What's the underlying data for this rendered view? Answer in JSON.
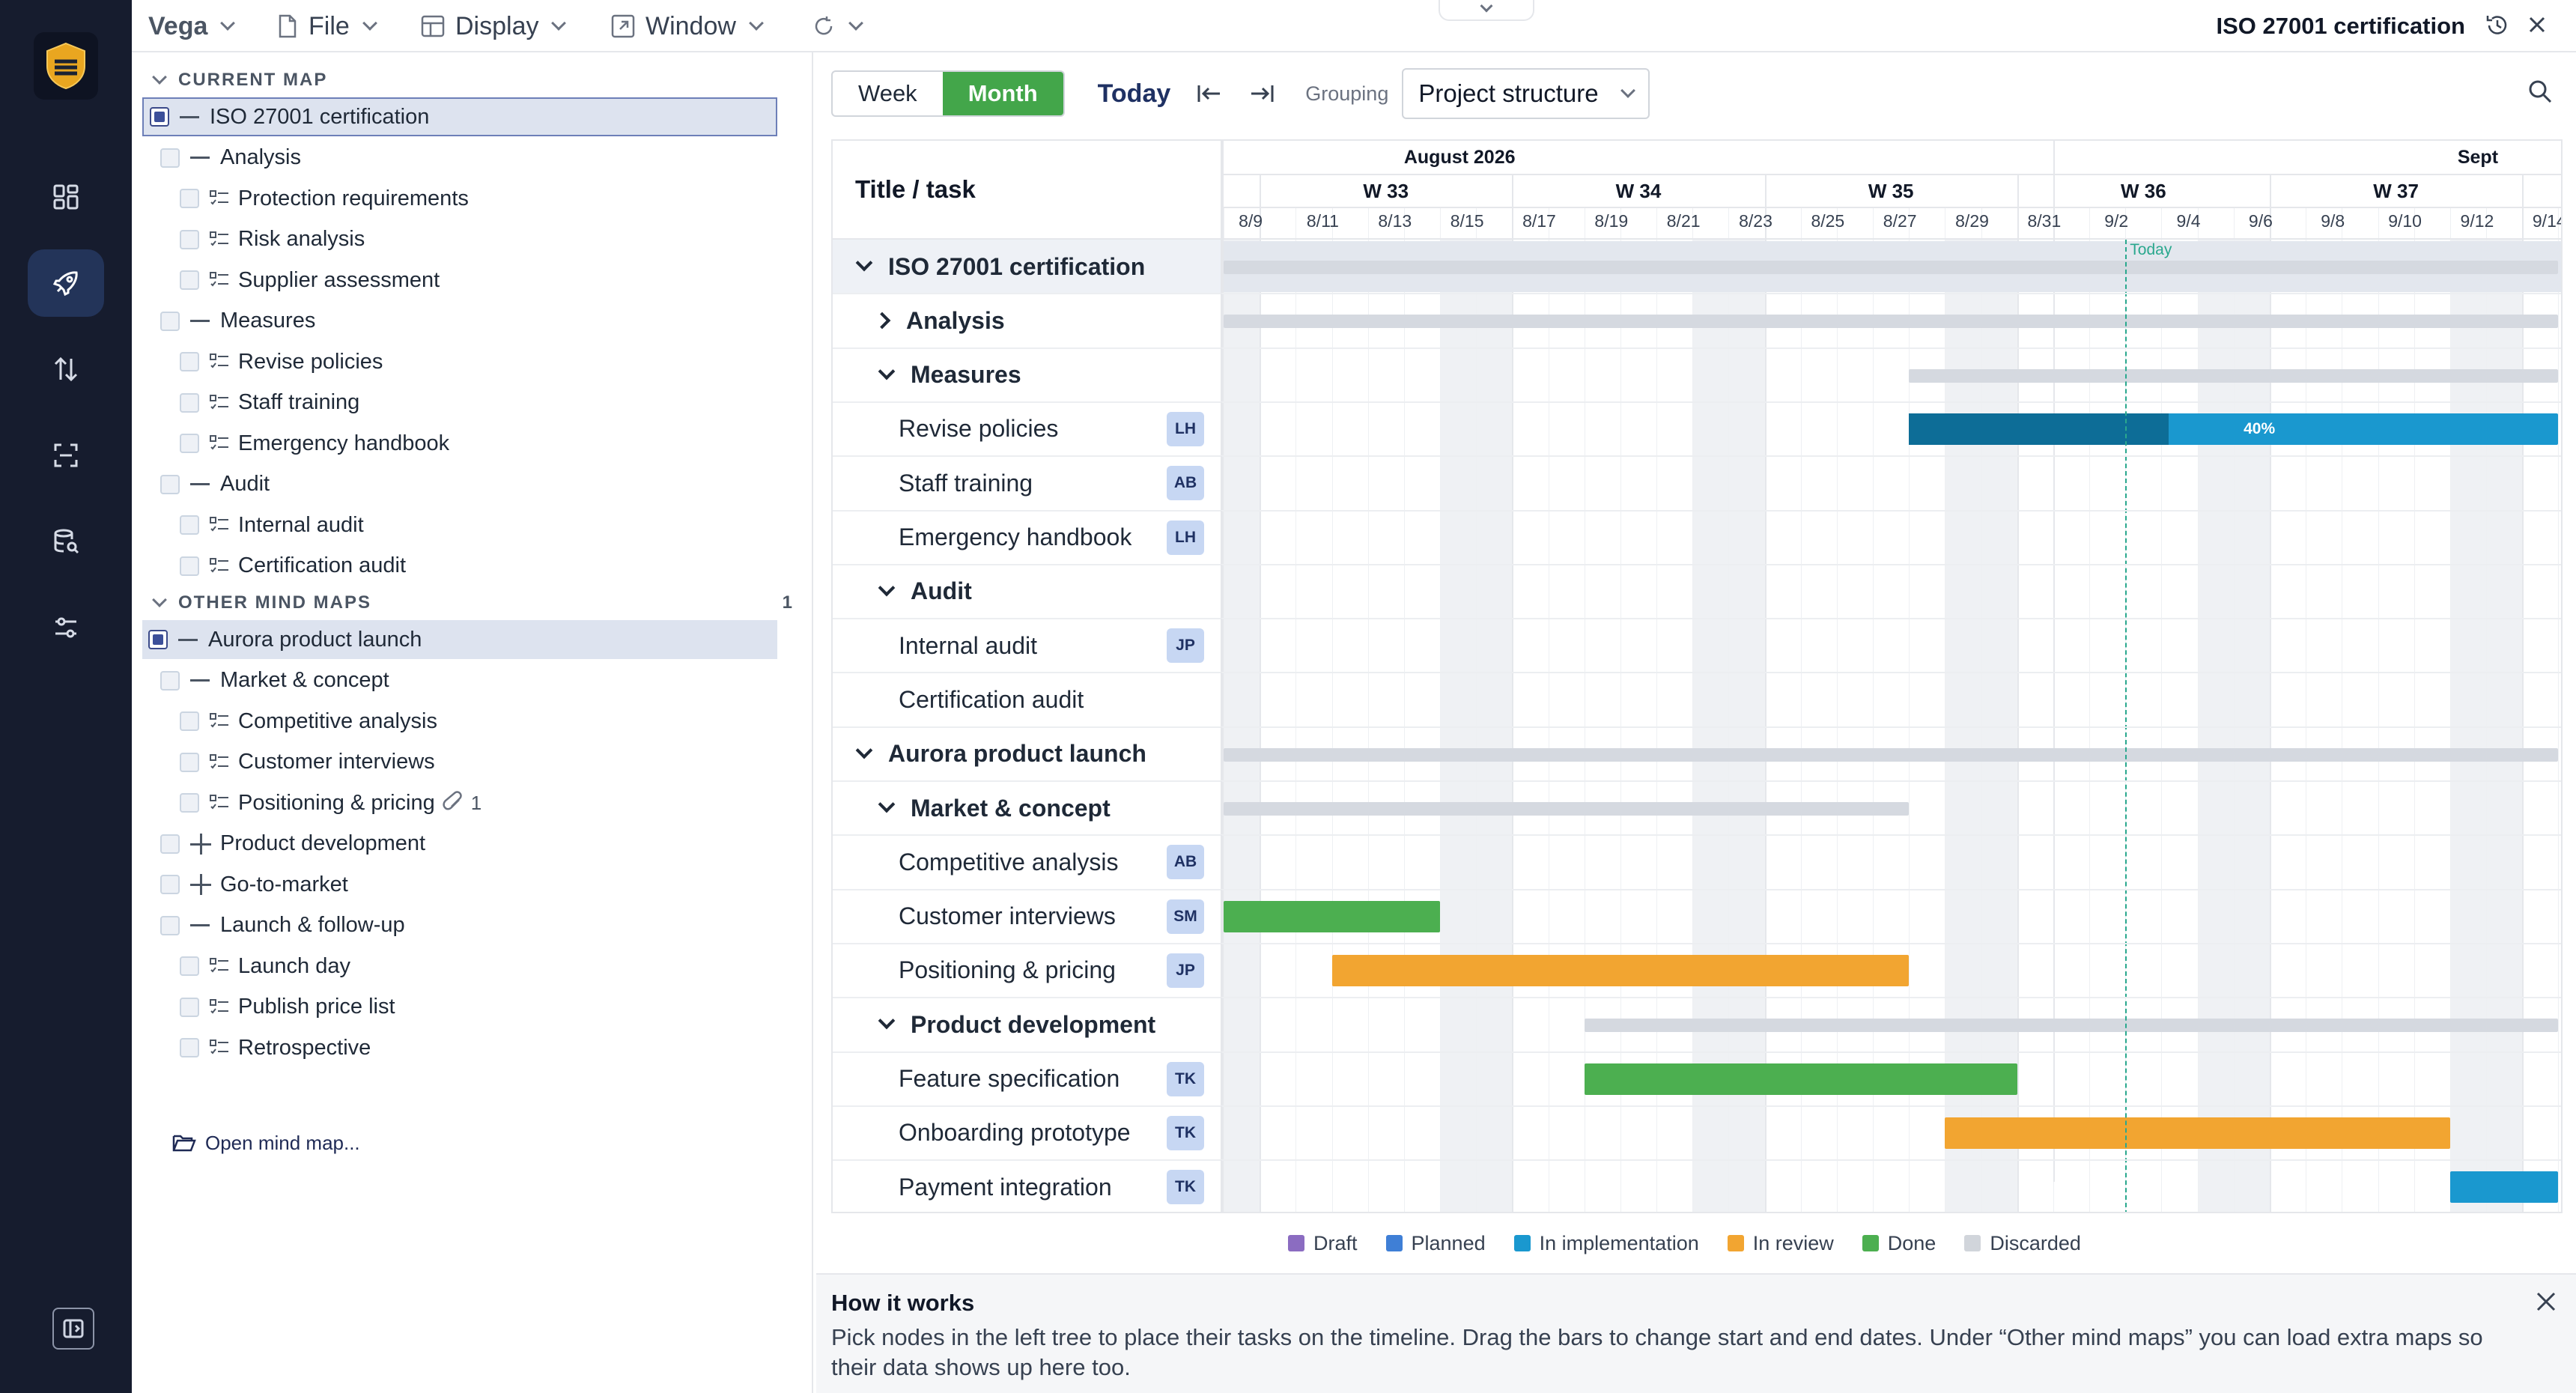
{
  "app": {
    "name": "Vega",
    "doc_title": "ISO 27001 certification"
  },
  "menu": {
    "file": "File",
    "display": "Display",
    "window": "Window"
  },
  "sidebar": {
    "current_label": "CURRENT MAP",
    "other_label": "OTHER MIND MAPS",
    "other_count": "1",
    "open_map": "Open mind map...",
    "current": [
      {
        "label": "ISO 27001 certification",
        "level": 0,
        "kind": "dash",
        "checked": true
      },
      {
        "label": "Analysis",
        "level": 1,
        "kind": "dash"
      },
      {
        "label": "Protection requirements",
        "level": 2,
        "kind": "task"
      },
      {
        "label": "Risk analysis",
        "level": 2,
        "kind": "task"
      },
      {
        "label": "Supplier assessment",
        "level": 2,
        "kind": "task"
      },
      {
        "label": "Measures",
        "level": 1,
        "kind": "dash"
      },
      {
        "label": "Revise policies",
        "level": 2,
        "kind": "task"
      },
      {
        "label": "Staff training",
        "level": 2,
        "kind": "task"
      },
      {
        "label": "Emergency handbook",
        "level": 2,
        "kind": "task"
      },
      {
        "label": "Audit",
        "level": 1,
        "kind": "dash"
      },
      {
        "label": "Internal audit",
        "level": 2,
        "kind": "task"
      },
      {
        "label": "Certification audit",
        "level": 2,
        "kind": "task"
      }
    ],
    "other": [
      {
        "label": "Aurora product launch",
        "level": 0,
        "kind": "dash",
        "checked": true
      },
      {
        "label": "Market & concept",
        "level": 1,
        "kind": "dash"
      },
      {
        "label": "Competitive analysis",
        "level": 2,
        "kind": "task"
      },
      {
        "label": "Customer interviews",
        "level": 2,
        "kind": "task"
      },
      {
        "label": "Positioning & pricing",
        "level": 2,
        "kind": "task",
        "attachments": "1"
      },
      {
        "label": "Product development",
        "level": 1,
        "kind": "plus"
      },
      {
        "label": "Go-to-market",
        "level": 1,
        "kind": "plus"
      },
      {
        "label": "Launch & follow-up",
        "level": 1,
        "kind": "dash"
      },
      {
        "label": "Launch day",
        "level": 2,
        "kind": "task"
      },
      {
        "label": "Publish price list",
        "level": 2,
        "kind": "task"
      },
      {
        "label": "Retrospective",
        "level": 2,
        "kind": "task"
      }
    ]
  },
  "toolbar": {
    "week": "Week",
    "month": "Month",
    "today": "Today",
    "grouping_label": "Grouping",
    "grouping_value": "Project structure"
  },
  "gantt": {
    "task_header": "Title / task",
    "months": [
      "August 2026",
      "Sept"
    ],
    "weeks": [
      "W 33",
      "W 34",
      "W 35",
      "W 36",
      "W 37"
    ],
    "days": [
      "8/9",
      "8/11",
      "8/13",
      "8/15",
      "8/17",
      "8/19",
      "8/21",
      "8/23",
      "8/25",
      "8/27",
      "8/29",
      "8/31",
      "9/2",
      "9/4",
      "9/6",
      "9/8",
      "9/10",
      "9/12",
      "9/14"
    ],
    "today_label": "Today",
    "today_date": "2026-09-03",
    "rows": [
      {
        "label": "ISO 27001 certification",
        "group": true,
        "level": 0,
        "expanded": true,
        "summary": [
          "2026-08-09",
          "2026-09-15"
        ]
      },
      {
        "label": "Analysis",
        "group": true,
        "level": 1,
        "expanded": false,
        "summary": [
          "2026-08-09",
          "2026-09-15"
        ]
      },
      {
        "label": "Measures",
        "group": true,
        "level": 1,
        "expanded": true,
        "summary": [
          "2026-08-28",
          "2026-09-15"
        ]
      },
      {
        "label": "Revise policies",
        "level": 2,
        "assignee": "LH",
        "status": "In implementation",
        "start": "2026-08-28",
        "end": "2026-09-15",
        "progress": 40
      },
      {
        "label": "Staff training",
        "level": 2,
        "assignee": "AB"
      },
      {
        "label": "Emergency handbook",
        "level": 2,
        "assignee": "LH"
      },
      {
        "label": "Audit",
        "group": true,
        "level": 1,
        "expanded": true
      },
      {
        "label": "Internal audit",
        "level": 2,
        "assignee": "JP"
      },
      {
        "label": "Certification audit",
        "level": 2
      },
      {
        "label": "Aurora product launch",
        "group": true,
        "level": 0,
        "expanded": true,
        "summary": [
          "2026-08-09",
          "2026-09-15"
        ]
      },
      {
        "label": "Market & concept",
        "group": true,
        "level": 1,
        "expanded": true,
        "summary": [
          "2026-08-09",
          "2026-08-28"
        ]
      },
      {
        "label": "Competitive analysis",
        "level": 2,
        "assignee": "AB"
      },
      {
        "label": "Customer interviews",
        "level": 2,
        "assignee": "SM",
        "status": "Done",
        "start": "2026-08-09",
        "end": "2026-08-15"
      },
      {
        "label": "Positioning & pricing",
        "level": 2,
        "assignee": "JP",
        "status": "In review",
        "start": "2026-08-12",
        "end": "2026-08-28"
      },
      {
        "label": "Product development",
        "group": true,
        "level": 1,
        "expanded": true,
        "summary": [
          "2026-08-19",
          "2026-09-15"
        ]
      },
      {
        "label": "Feature specification",
        "level": 2,
        "assignee": "TK",
        "status": "Done",
        "start": "2026-08-19",
        "end": "2026-08-31"
      },
      {
        "label": "Onboarding prototype",
        "level": 2,
        "assignee": "TK",
        "status": "In review",
        "start": "2026-08-29",
        "end": "2026-09-12"
      },
      {
        "label": "Payment integration",
        "level": 2,
        "assignee": "TK",
        "status": "In implementation",
        "start": "2026-09-12",
        "end": "2026-09-15"
      }
    ]
  },
  "legend": [
    {
      "label": "Draft",
      "color": "#8b6cc1"
    },
    {
      "label": "Planned",
      "color": "#3f7fd6"
    },
    {
      "label": "In implementation",
      "color": "#1a98cf"
    },
    {
      "label": "In review",
      "color": "#f2a531"
    },
    {
      "label": "Done",
      "color": "#4caf50"
    },
    {
      "label": "Discarded",
      "color": "#d1d5db"
    }
  ],
  "status_colors": {
    "In implementation": "#1a98cf",
    "In implementation done part": "#0d6d97",
    "In review": "#f2a531",
    "Done": "#4caf50"
  },
  "info": {
    "title": "How it works",
    "text": "Pick nodes in the left tree to place their tasks on the timeline. Drag the bars to change start and end dates. Under “Other mind maps” you can load extra maps so their data shows up here too."
  }
}
